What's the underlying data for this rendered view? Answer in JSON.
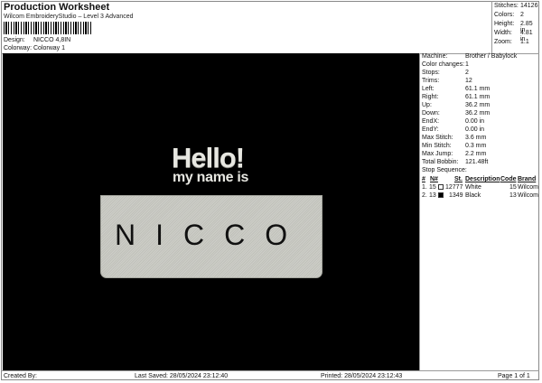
{
  "header": {
    "title": "Production Worksheet",
    "subtitle": "Wilcom EmbroideryStudio – Level 3 Advanced",
    "design_label": "Design:",
    "design_value": "NICCO 4,8IN",
    "colorway_label": "Colorway:",
    "colorway_value": "Colorway 1"
  },
  "summary": [
    {
      "label": "Stitches:",
      "value": "14126"
    },
    {
      "label": "Colors:",
      "value": "2"
    },
    {
      "label": "Height:",
      "value": "2.85 in"
    },
    {
      "label": "Width:",
      "value": "4.81 in"
    },
    {
      "label": "Zoom:",
      "value": "1:1"
    }
  ],
  "design_preview": {
    "hello": "Hello!",
    "my_name_is": "my name is",
    "name": "NICCO"
  },
  "info": [
    {
      "label": "Machine:",
      "value": "Brother / Babylock"
    },
    {
      "label": "Color changes:",
      "value": "1"
    },
    {
      "label": "Stops:",
      "value": "2"
    },
    {
      "label": "Trims:",
      "value": "12"
    },
    {
      "label": "Left:",
      "value": "61.1 mm"
    },
    {
      "label": "Right:",
      "value": "61.1 mm"
    },
    {
      "label": "Up:",
      "value": "36.2 mm"
    },
    {
      "label": "Down:",
      "value": "36.2 mm"
    },
    {
      "label": "EndX:",
      "value": "0.00 in"
    },
    {
      "label": "EndY:",
      "value": "0.00 in"
    },
    {
      "label": "Max Stitch:",
      "value": "3.6 mm"
    },
    {
      "label": "Min Stitch:",
      "value": "0.3 mm"
    },
    {
      "label": "Max Jump:",
      "value": "2.2 mm"
    },
    {
      "label": "Total Bobbin:",
      "value": "121.48ft"
    }
  ],
  "stop_sequence": {
    "title": "Stop Sequence:",
    "headers": [
      "#",
      "N#",
      "St.",
      "Description",
      "Code",
      "Brand"
    ],
    "rows": [
      {
        "idx": "1.",
        "n": "15",
        "st": "12777",
        "desc": "White",
        "code": "15",
        "brand": "Wilcom",
        "color": "#ffffff"
      },
      {
        "idx": "2.",
        "n": "13",
        "st": "1349",
        "desc": "Black",
        "code": "13",
        "brand": "Wilcom",
        "color": "#000000"
      }
    ]
  },
  "footer": {
    "created_by": "Created By:",
    "last_saved": "Last Saved: 28/05/2024 23:12:40",
    "printed": "Printed: 28/05/2024 23:12:43",
    "page": "Page 1 of 1"
  }
}
